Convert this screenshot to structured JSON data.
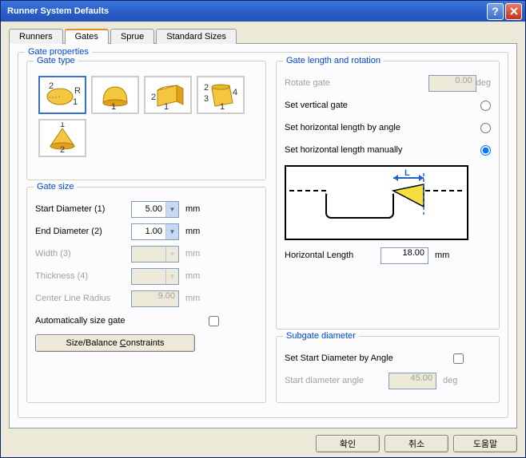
{
  "window": {
    "title": "Runner System Defaults"
  },
  "tabs": {
    "runners": "Runners",
    "gates": "Gates",
    "sprue": "Sprue",
    "standard": "Standard Sizes"
  },
  "gateProperties": {
    "legend": "Gate properties",
    "gateTypeLegend": "Gate type"
  },
  "gateSize": {
    "legend": "Gate size",
    "startDiameter": "Start Diameter (1)",
    "startDiameterVal": "5.00",
    "endDiameter": "End Diameter (2)",
    "endDiameterVal": "1.00",
    "width": "Width (3)",
    "widthVal": "",
    "thickness": "Thickness (4)",
    "thicknessVal": "",
    "centerLineRadius": "Center Line Radius",
    "centerLineRadiusVal": "9.00",
    "unit": "mm",
    "autoSize": "Automatically size gate",
    "sizeBalance": "Size/Balance Constraints"
  },
  "gateLength": {
    "legend": "Gate length and rotation",
    "rotateGate": "Rotate gate",
    "rotateGateVal": "0.00",
    "deg": "deg",
    "setVertical": "Set vertical gate",
    "setHorizAngle": "Set horizontal length by angle",
    "setHorizManual": "Set horizontal length manually",
    "horizLength": "Horizontal Length",
    "horizLengthVal": "18.00",
    "unit": "mm",
    "dimL": "L"
  },
  "subgate": {
    "legend": "Subgate diameter",
    "setByAngle": "Set Start Diameter by Angle",
    "startAngle": "Start diameter angle",
    "startAngleVal": "45.00",
    "deg": "deg"
  },
  "footer": {
    "ok": "확인",
    "cancel": "취소",
    "help": "도움말"
  }
}
